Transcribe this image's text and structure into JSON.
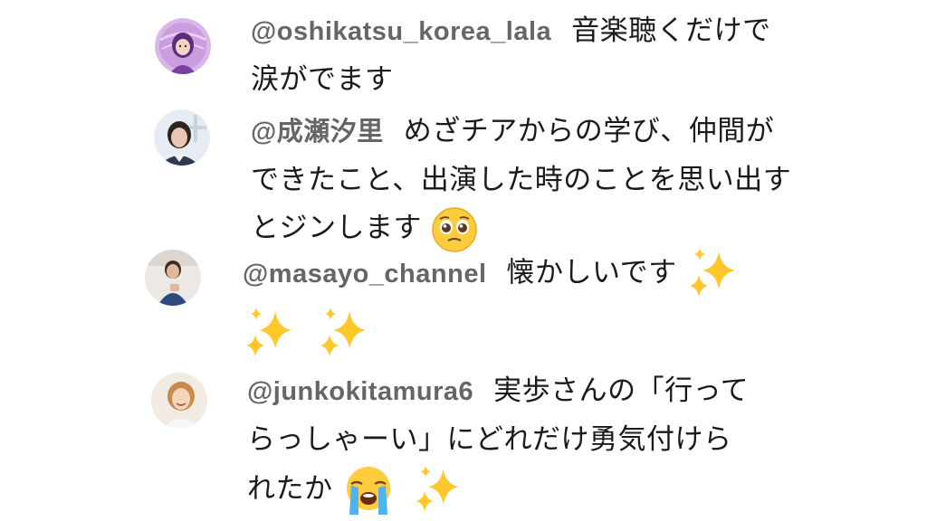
{
  "comments": [
    {
      "handle": "@oshikatsu_korea_lala",
      "text": "音楽聴くだけで涙がでます",
      "avatar": "illustrated-girl-avatar"
    },
    {
      "handle": "@成瀬汐里",
      "text": "めざチアからの学び、仲間ができたこと、出演した時のことを思い出すとジンします",
      "emoji": "pleading-face-emoji",
      "avatar": "woman-photo-avatar"
    },
    {
      "handle": "@masayo_channel",
      "text": "懐かしいです",
      "emoji": "sparkles-emoji",
      "avatar": "person-photo-avatar"
    },
    {
      "handle": "@junkokitamura6",
      "text": "実歩さんの「行ってらっしゃーい」にどれだけ勇気付けられたか",
      "emoji": "loudly-crying-face-emoji",
      "avatar": "smiling-woman-photo-avatar"
    }
  ],
  "colors": {
    "handle": "#666666",
    "text": "#1a1a1a",
    "background": "#ffffff"
  }
}
